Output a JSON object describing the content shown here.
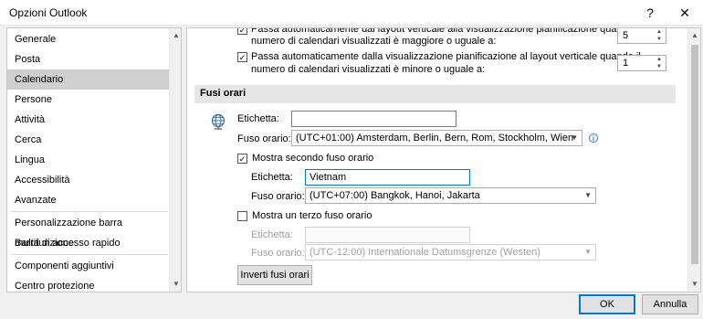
{
  "window": {
    "title": "Opzioni Outlook",
    "help_label": "?",
    "close_label": "✕"
  },
  "nav": {
    "items": [
      {
        "label": "Generale"
      },
      {
        "label": "Posta"
      },
      {
        "label": "Calendario",
        "selected": true
      },
      {
        "label": "Persone"
      },
      {
        "label": "Attività"
      },
      {
        "label": "Cerca"
      },
      {
        "label": "Lingua"
      },
      {
        "label": "Accessibilità"
      },
      {
        "label": "Avanzate"
      },
      {
        "label": "Personalizzazione barra multifunzione"
      },
      {
        "label": "Barra di accesso rapido"
      },
      {
        "label": "Componenti aggiuntivi"
      },
      {
        "label": "Centro protezione"
      }
    ]
  },
  "options": {
    "opt1_line1": "Passa automaticamente dal layout verticale alla visualizzazione pianificazione quando il",
    "opt1_line2": "numero di calendari visualizzati è maggiore o uguale a:",
    "opt1_value": "5",
    "opt2_line1": "Passa automaticamente dalla visualizzazione pianificazione al layout verticale quando il",
    "opt2_line2": "numero di calendari visualizzati è minore o uguale a:",
    "opt2_value": "1"
  },
  "timezones": {
    "section_title": "Fusi orari",
    "label_caption": "Etichetta:",
    "label_value": "",
    "tz_caption": "Fuso orario:",
    "tz_value": "(UTC+01:00) Amsterdam, Berlin, Bern, Rom, Stockholm, Wien",
    "second_check_label": "Mostra secondo fuso orario",
    "second_checked": true,
    "second_label_caption": "Etichetta:",
    "second_label_value": "Vietnam",
    "second_tz_caption": "Fuso orario:",
    "second_tz_value": "(UTC+07:00) Bangkok, Hanoi, Jakarta",
    "third_check_label": "Mostra un terzo fuso orario",
    "third_checked": false,
    "third_label_caption": "Etichetta:",
    "third_label_value": "",
    "third_tz_caption": "Fuso orario:",
    "third_tz_value": "(UTC-12:00) Internationale Datumsgrenze (Westen)",
    "swap_button": "Inverti fusi orari"
  },
  "footer": {
    "ok_label": "OK",
    "cancel_label": "Annulla"
  }
}
